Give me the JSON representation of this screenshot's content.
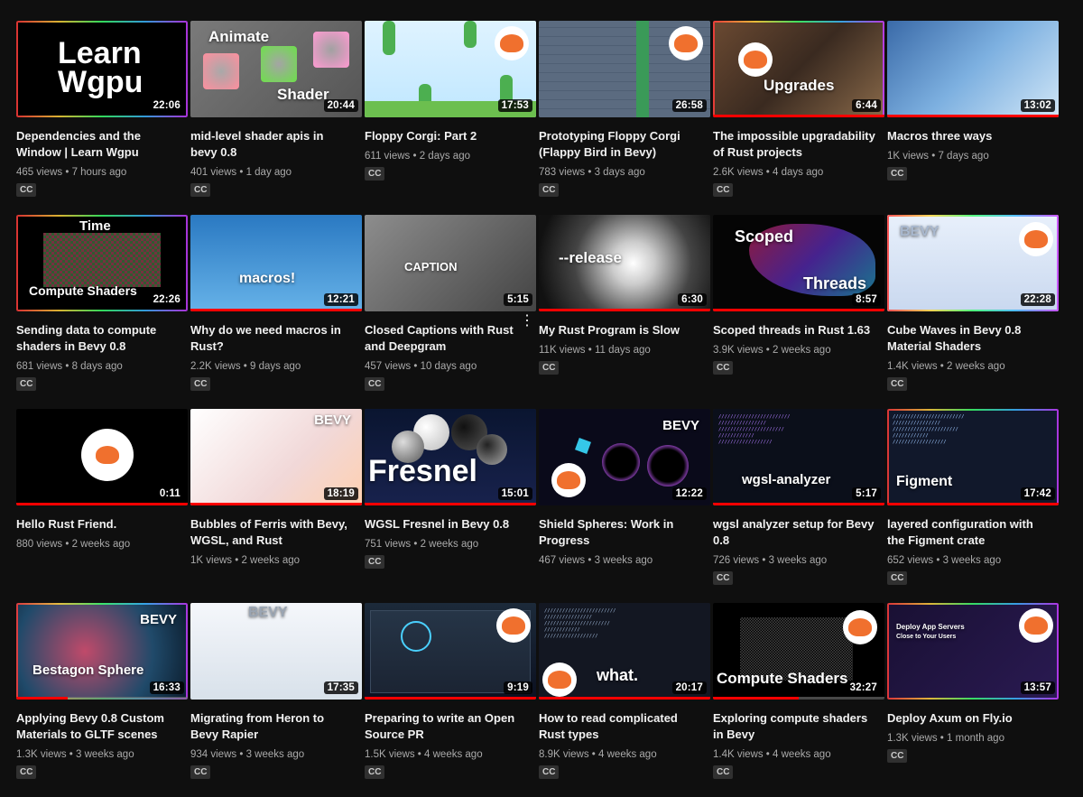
{
  "colors": {
    "background": "#0f0f0f",
    "progress": "#ff0000",
    "meta": "#aaaaaa"
  },
  "videos": [
    {
      "title": "Dependencies and the Window | Learn Wgpu",
      "views": "465 views",
      "age": "7 hours ago",
      "duration": "22:06",
      "cc": "CC",
      "thumb_text": "Learn Wgpu",
      "progress": 0
    },
    {
      "title": "mid-level shader apis in bevy 0.8",
      "views": "401 views",
      "age": "1 day ago",
      "duration": "20:44",
      "cc": "CC",
      "thumb_text": "Animate",
      "thumb_text2": "Shader",
      "progress": 0
    },
    {
      "title": "Floppy Corgi: Part 2",
      "views": "611 views",
      "age": "2 days ago",
      "duration": "17:53",
      "cc": "CC",
      "progress": 0
    },
    {
      "title": "Prototyping Floppy Corgi (Flappy Bird in Bevy)",
      "views": "783 views",
      "age": "3 days ago",
      "duration": "26:58",
      "cc": "CC",
      "progress": 0
    },
    {
      "title": "The impossible upgradability of Rust projects",
      "views": "2.6K views",
      "age": "4 days ago",
      "duration": "6:44",
      "cc": "CC",
      "thumb_text": "Upgrades",
      "progress": 1.0
    },
    {
      "title": "Macros three ways",
      "views": "1K views",
      "age": "7 days ago",
      "duration": "13:02",
      "cc": "CC",
      "progress": 1.0
    },
    {
      "title": "Sending data to compute shaders in Bevy 0.8",
      "views": "681 views",
      "age": "8 days ago",
      "duration": "22:26",
      "cc": "CC",
      "thumb_text": "Time",
      "thumb_text2": "Compute Shaders",
      "progress": 0
    },
    {
      "title": "Why do we need macros in Rust?",
      "views": "2.2K views",
      "age": "9 days ago",
      "duration": "12:21",
      "cc": "CC",
      "thumb_text": "macros!",
      "progress": 1.0
    },
    {
      "title": "Closed Captions with Rust and Deepgram",
      "views": "457 views",
      "age": "10 days ago",
      "duration": "5:15",
      "cc": "CC",
      "thumb_text": "CAPTION",
      "progress": 0
    },
    {
      "title": "My Rust Program is Slow",
      "views": "11K views",
      "age": "11 days ago",
      "duration": "6:30",
      "cc": "CC",
      "thumb_text": "--release",
      "progress": 1.0
    },
    {
      "title": "Scoped threads in Rust 1.63",
      "views": "3.9K views",
      "age": "2 weeks ago",
      "duration": "8:57",
      "cc": "CC",
      "thumb_text": "Scoped",
      "thumb_text2": "Threads",
      "progress": 1.0
    },
    {
      "title": "Cube Waves in Bevy 0.8 Material Shaders",
      "views": "1.4K views",
      "age": "2 weeks ago",
      "duration": "22:28",
      "cc": "CC",
      "thumb_text": "BEVY",
      "progress": 0
    },
    {
      "title": "Hello Rust Friend.",
      "views": "880 views",
      "age": "2 weeks ago",
      "duration": "0:11",
      "cc": "",
      "progress": 1.0
    },
    {
      "title": "Bubbles of Ferris with Bevy, WGSL, and Rust",
      "views": "1K views",
      "age": "2 weeks ago",
      "duration": "18:19",
      "cc": "",
      "thumb_text": "BEVY",
      "progress": 1.0
    },
    {
      "title": "WGSL Fresnel in Bevy 0.8",
      "views": "751 views",
      "age": "2 weeks ago",
      "duration": "15:01",
      "cc": "CC",
      "thumb_text": "Fresnel",
      "progress": 1.0
    },
    {
      "title": "Shield Spheres: Work in Progress",
      "views": "467 views",
      "age": "3 weeks ago",
      "duration": "12:22",
      "cc": "",
      "thumb_text": "BEVY",
      "progress": 0
    },
    {
      "title": "wgsl analyzer setup for Bevy 0.8",
      "views": "726 views",
      "age": "3 weeks ago",
      "duration": "5:17",
      "cc": "CC",
      "thumb_text": "wgsl-analyzer",
      "progress": 1.0
    },
    {
      "title": "layered configuration with the Figment crate",
      "views": "652 views",
      "age": "3 weeks ago",
      "duration": "17:42",
      "cc": "CC",
      "thumb_text": "Figment",
      "progress": 1.0
    },
    {
      "title": "Applying Bevy 0.8 Custom Materials to GLTF scenes",
      "views": "1.3K views",
      "age": "3 weeks ago",
      "duration": "16:33",
      "cc": "CC",
      "thumb_text": "BEVY",
      "thumb_text2": "Bestagon Sphere",
      "progress": 0.3
    },
    {
      "title": "Migrating from Heron to Bevy Rapier",
      "views": "934 views",
      "age": "3 weeks ago",
      "duration": "17:35",
      "cc": "CC",
      "thumb_text": "BEVY",
      "progress": 0
    },
    {
      "title": "Preparing to write an Open Source PR",
      "views": "1.5K views",
      "age": "4 weeks ago",
      "duration": "9:19",
      "cc": "CC",
      "progress": 1.0
    },
    {
      "title": "How to read complicated Rust types",
      "views": "8.9K views",
      "age": "4 weeks ago",
      "duration": "20:17",
      "cc": "CC",
      "thumb_text": "what.",
      "progress": 1.0
    },
    {
      "title": "Exploring compute shaders in Bevy",
      "views": "1.4K views",
      "age": "4 weeks ago",
      "duration": "32:27",
      "cc": "CC",
      "thumb_text": "Compute Shaders",
      "progress": 0.5
    },
    {
      "title": "Deploy Axum on Fly.io",
      "views": "1.3K views",
      "age": "1 month ago",
      "duration": "13:57",
      "cc": "CC",
      "thumb_text": "Deploy App Servers",
      "thumb_text2": "Close to Your Users",
      "progress": 0
    }
  ]
}
